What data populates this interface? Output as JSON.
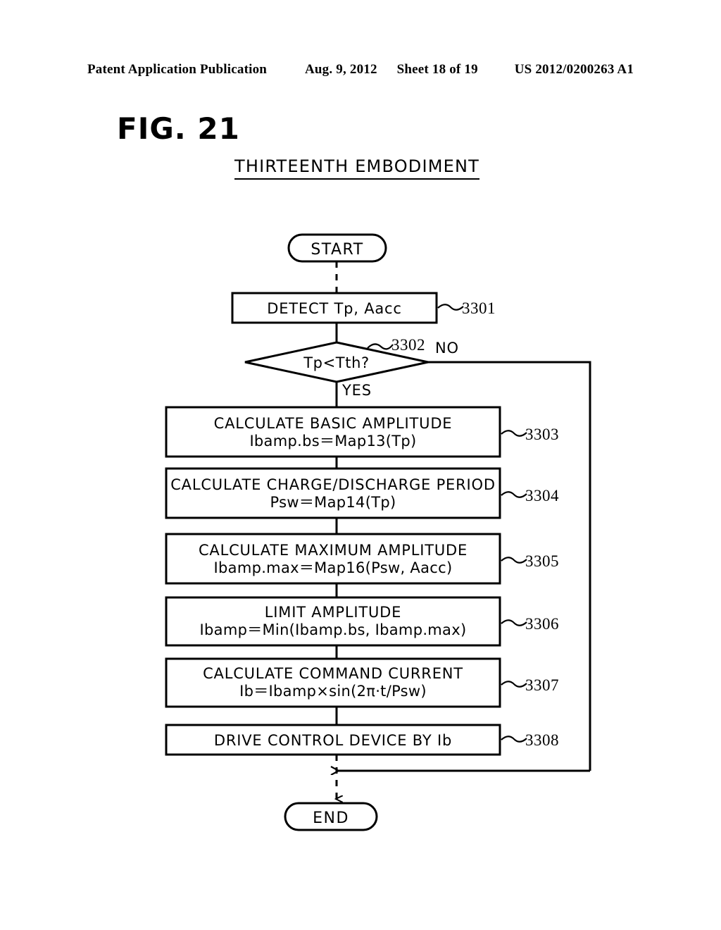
{
  "header": {
    "publication": "Patent Application Publication",
    "date": "Aug. 9, 2012",
    "sheet": "Sheet 18 of 19",
    "number": "US 2012/0200263 A1"
  },
  "figure": {
    "number": "FIG. 21",
    "title": "THIRTEENTH EMBODIMENT"
  },
  "flowchart": {
    "start": {
      "label": "START"
    },
    "end": {
      "label": "END"
    },
    "branch_yes": "YES",
    "branch_no": "NO",
    "decision": {
      "label": "Tp<Tth?",
      "ref": "3302"
    },
    "steps": [
      {
        "ref": "3301",
        "line1": "DETECT Tp, Aacc",
        "line2": ""
      },
      {
        "ref": "3303",
        "line1": "CALCULATE BASIC AMPLITUDE",
        "line2": "Ibamp.bs＝Map13(Tp)"
      },
      {
        "ref": "3304",
        "line1": "CALCULATE CHARGE/DISCHARGE PERIOD",
        "line2": "Psw＝Map14(Tp)"
      },
      {
        "ref": "3305",
        "line1": "CALCULATE MAXIMUM AMPLITUDE",
        "line2": "Ibamp.max＝Map16(Psw, Aacc)"
      },
      {
        "ref": "3306",
        "line1": "LIMIT AMPLITUDE",
        "line2": "Ibamp＝Min(Ibamp.bs, Ibamp.max)"
      },
      {
        "ref": "3307",
        "line1": "CALCULATE COMMAND CURRENT",
        "line2": "Ib＝Ibamp×sin(2π·t/Psw)"
      },
      {
        "ref": "3308",
        "line1": "DRIVE CONTROL DEVICE BY Ib",
        "line2": ""
      }
    ],
    "colors": {
      "ink": "#000000",
      "paper": "#ffffff"
    }
  }
}
